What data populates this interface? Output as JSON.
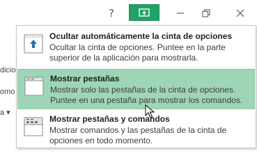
{
  "titlebar": {
    "help_label": "?",
    "ribbon_toggle_icon": "ribbon-display-options-icon",
    "minimize_icon": "minimize-icon",
    "restore_icon": "restore-icon",
    "close_icon": "close-icon"
  },
  "background": {
    "line1": "dicio",
    "line2": "omo",
    "line3": "a ▾"
  },
  "menu": {
    "items": [
      {
        "title": "Ocultar automáticamente la cinta de opciones",
        "description": "Ocultar la cinta de opciones. Puntee en la parte superior de la aplicación para mostrarla.",
        "icon": "auto-hide-ribbon-icon"
      },
      {
        "title": "Mostrar pestañas",
        "description": "Mostrar solo las pestañas de la cinta de opciones. Puntee en una pestaña para mostrar los comandos.",
        "icon": "show-tabs-icon"
      },
      {
        "title": "Mostrar pestañas y comandos",
        "description": "Mostrar comandos y las pestañas de la cinta de opciones en todo momento.",
        "icon": "show-tabs-and-commands-icon"
      }
    ]
  },
  "colors": {
    "accent": "#21a366",
    "highlight": "#9fd5b7"
  }
}
